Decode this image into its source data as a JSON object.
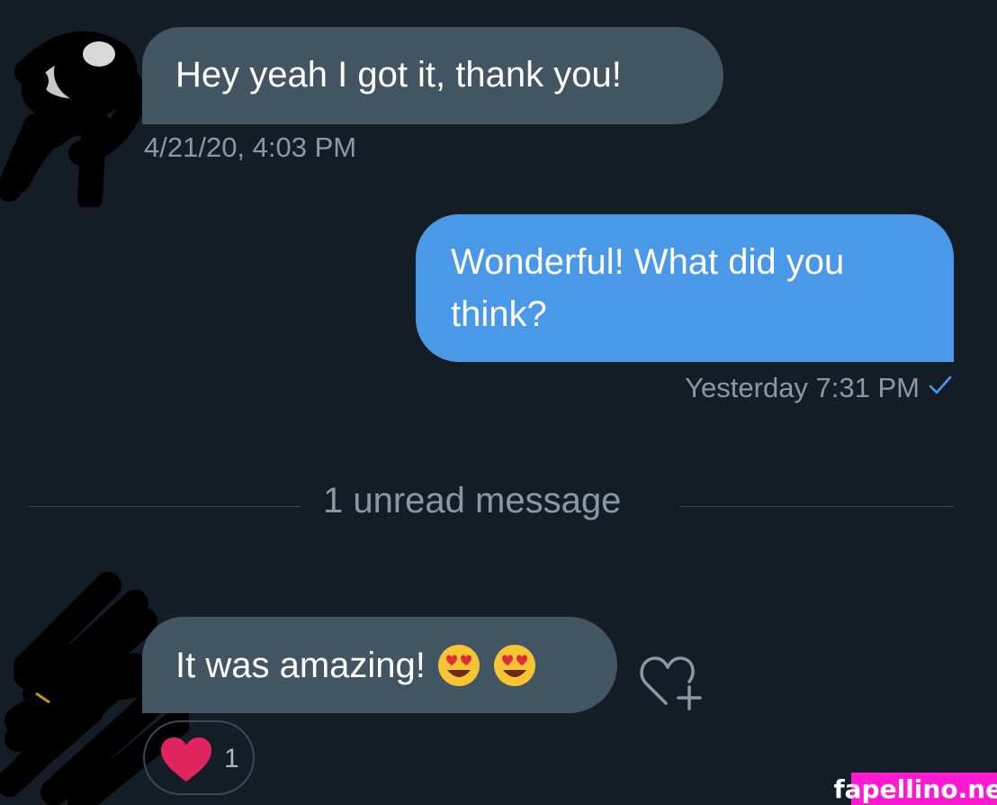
{
  "messages": [
    {
      "text": "Hey yeah I got it, thank you!",
      "timestamp": "4/21/20, 4:03 PM",
      "direction": "incoming"
    },
    {
      "text": "Wonderful! What did you think?",
      "timestamp": "Yesterday 7:31 PM",
      "direction": "outgoing",
      "status_icon": "checkmark-icon"
    },
    {
      "text": "It was amazing!",
      "emojis": [
        "heart-eyes-emoji",
        "heart-eyes-emoji"
      ],
      "direction": "incoming"
    }
  ],
  "divider": {
    "label": "1 unread message"
  },
  "reaction": {
    "icon": "heart-icon",
    "count": "1"
  },
  "watermark": {
    "text": "fapellino.net"
  },
  "colors": {
    "background": "#141d26",
    "incoming_bubble": "#425563",
    "outgoing_bubble": "#4a99e9",
    "secondary_text": "#8899a6",
    "heart": "#e0245e",
    "watermark": "#ff1ad1"
  }
}
